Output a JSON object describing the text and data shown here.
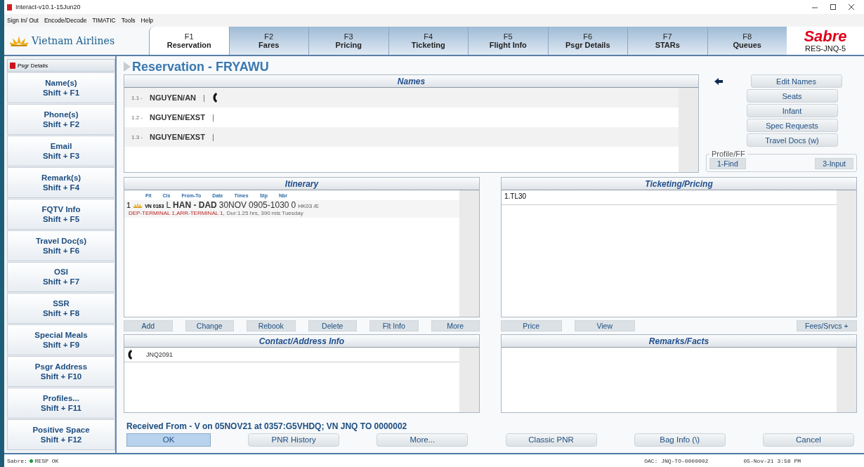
{
  "window": {
    "title": "Interact-v10.1-15Jun20"
  },
  "menu": [
    "Sign In/ Out",
    "Encode/Decode",
    "TIMATIC",
    "Tools",
    "Help"
  ],
  "airline_logo": "Vietnam Airlines",
  "tabs": [
    {
      "key": "F1",
      "label": "Reservation",
      "selected": true
    },
    {
      "key": "F2",
      "label": "Fares",
      "selected": false
    },
    {
      "key": "F3",
      "label": "Pricing",
      "selected": false
    },
    {
      "key": "F4",
      "label": "Ticketing",
      "selected": false
    },
    {
      "key": "F5",
      "label": "Flight Info",
      "selected": false
    },
    {
      "key": "F6",
      "label": "Psgr Details",
      "selected": false
    },
    {
      "key": "F7",
      "label": "STARs",
      "selected": false
    },
    {
      "key": "F8",
      "label": "Queues",
      "selected": false
    }
  ],
  "brand": {
    "logo": "Sabre",
    "station": "RES-JNQ-5"
  },
  "sidebar": {
    "header": "Psgr Details",
    "items": [
      {
        "label": "Name(s)",
        "shortcut": "Shift + F1"
      },
      {
        "label": "Phone(s)",
        "shortcut": "Shift + F2"
      },
      {
        "label": "Email",
        "shortcut": "Shift + F3"
      },
      {
        "label": "Remark(s)",
        "shortcut": "Shift + F4"
      },
      {
        "label": "FQTV Info",
        "shortcut": "Shift + F5"
      },
      {
        "label": "Travel Doc(s)",
        "shortcut": "Shift + F6"
      },
      {
        "label": "OSI",
        "shortcut": "Shift + F7"
      },
      {
        "label": "SSR",
        "shortcut": "Shift + F8"
      },
      {
        "label": "Special Meals",
        "shortcut": "Shift + F9"
      },
      {
        "label": "Psgr Address",
        "shortcut": "Shift + F10"
      },
      {
        "label": "Profiles...",
        "shortcut": "Shift + F11"
      },
      {
        "label": "Positive Space",
        "shortcut": "Shift + F12"
      }
    ]
  },
  "page_title": "Reservation - FRYAWU",
  "names": {
    "title": "Names",
    "rows": [
      {
        "number": "1.1 -",
        "name": "NGUYEN/AN",
        "separator": "|",
        "phone": true
      },
      {
        "number": "1.2 -",
        "name": "NGUYEN/EXST",
        "separator": "|",
        "phone": false
      },
      {
        "number": "1.3 -",
        "name": "NGUYEN/EXST",
        "separator": "|",
        "phone": false
      }
    ]
  },
  "name_buttons": [
    "Edit Names",
    "Seats",
    "Infant",
    "Spec Requests",
    "Travel Docs (w)"
  ],
  "profile": {
    "legend": "Profile/FF",
    "buttons": [
      "1-Find",
      "3-Input"
    ]
  },
  "itinerary": {
    "title": "Itinerary",
    "columns": [
      "Flt",
      "Cls",
      "From-To",
      "Date",
      "Times",
      "Stp",
      "Nbr"
    ],
    "segments": [
      {
        "line": "1",
        "flight": "VN 0163",
        "class": "L",
        "route": "HAN - DAD",
        "date": "30NOV",
        "times": "0905-1030",
        "stops": "0",
        "status": "HK03 /E",
        "terminals": "DEP-TERMINAL 1,ARR-TERMINAL 1,",
        "details": "Dur:1.25 hrs, 390 mls Tuesday"
      }
    ],
    "buttons": [
      "Add",
      "Change",
      "Rebook",
      "Delete",
      "Flt Info",
      "More"
    ]
  },
  "ticketing": {
    "title": "Ticketing/Pricing",
    "lines": [
      "1.TL30"
    ],
    "buttons": [
      "Price",
      "View"
    ],
    "extra_button": "Fees/Srvcs +"
  },
  "contact": {
    "title": "Contact/Address Info",
    "rows": [
      {
        "text": "JNQ2091"
      }
    ]
  },
  "remarks": {
    "title": "Remarks/Facts"
  },
  "received": "Received From - V on 05NOV21 at 0357:G5VHDQ; VN JNQ TO 0000002",
  "footer_buttons": [
    {
      "label": "OK",
      "selected": true
    },
    {
      "label": "PNR History",
      "selected": false
    },
    {
      "label": "More...",
      "selected": false
    },
    {
      "label": "Classic PNR",
      "selected": false
    },
    {
      "label": "Bag Info (\\)",
      "selected": false
    },
    {
      "label": "Cancel",
      "selected": false
    }
  ],
  "status_bar": {
    "system": "Sabre:",
    "response": "RESP OK",
    "oac": "OAC: JNQ-TO-0000002",
    "datetime": "05-Nov-21 3:58 PM"
  }
}
